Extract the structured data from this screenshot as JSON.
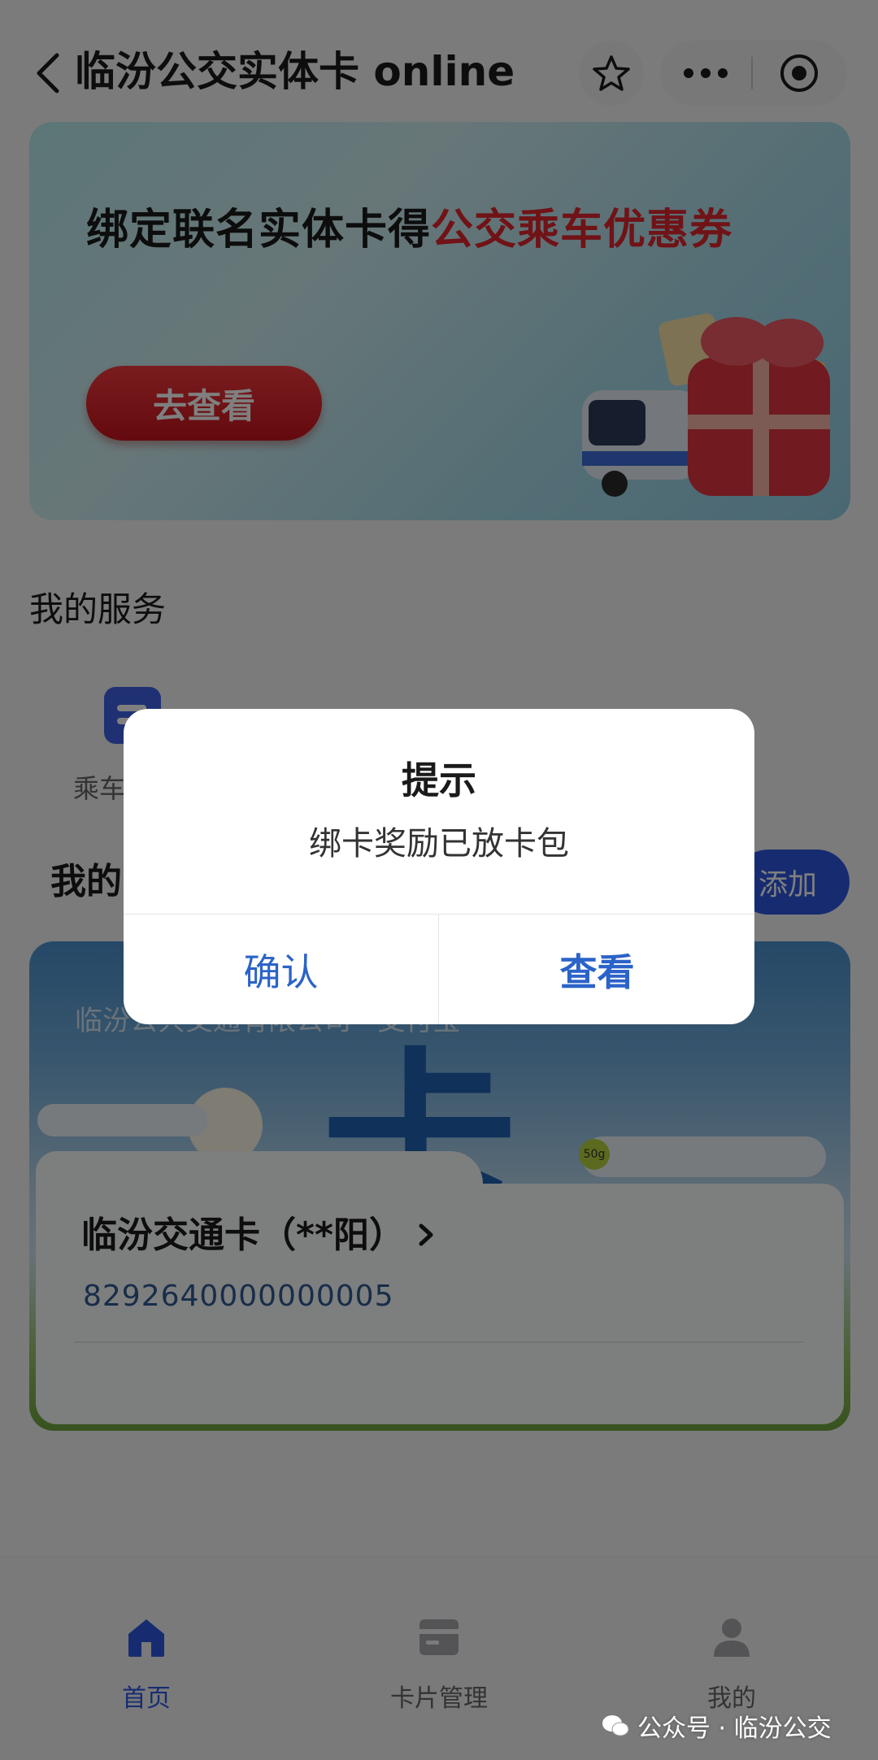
{
  "header": {
    "title": "临汾公交实体卡 online",
    "back_icon": "chevron-left-icon",
    "favorite_icon": "star-icon",
    "more_icon": "more-dots-icon",
    "close_icon": "close-miniprogram-icon"
  },
  "banner": {
    "headline_black": "绑定联名实体卡得",
    "headline_red": "公交乘车优惠券",
    "cta_label": "去查看",
    "accent_color": "#e0262f"
  },
  "services": {
    "title": "我的服务",
    "items": [
      {
        "label": "乘车",
        "icon": "ride-code-icon"
      }
    ]
  },
  "cards": {
    "title": "我的",
    "add_label": "添加"
  },
  "card": {
    "issuer": "临汾公共交通有限公司 · 支付宝",
    "big_char": "卡",
    "badge": "50g",
    "name": "临汾交通卡（**阳）",
    "number": "8292640000000005"
  },
  "tabbar": {
    "tabs": [
      {
        "label": "首页",
        "icon": "home-icon",
        "active": true
      },
      {
        "label": "卡片管理",
        "icon": "card-manage-icon",
        "active": false
      },
      {
        "label": "我的",
        "icon": "user-icon",
        "active": false
      }
    ]
  },
  "watermark": {
    "text": "公众号 · 临汾公交"
  },
  "dialog": {
    "title": "提示",
    "message": "绑卡奖励已放卡包",
    "confirm_label": "确认",
    "view_label": "查看",
    "button_color": "#2b63c8"
  }
}
